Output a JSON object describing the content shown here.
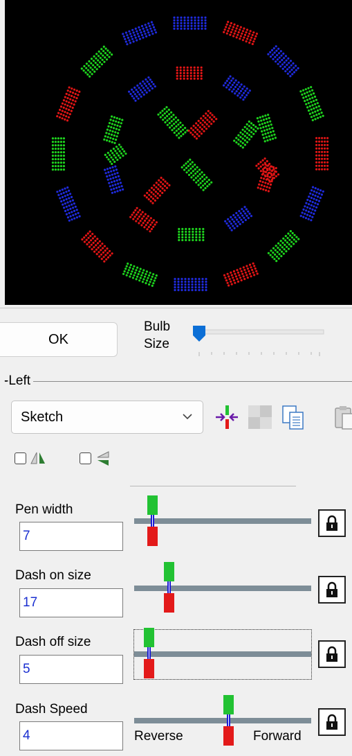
{
  "preview": {
    "icon": "led-dashed-circle-x-preview"
  },
  "controls": {
    "ok_label": "OK",
    "bulb_size_label_line1": "Bulb",
    "bulb_size_label_line2": "Size",
    "bulb_size_value": 0
  },
  "group": {
    "title": "Left"
  },
  "mode": {
    "selected": "Sketch"
  },
  "toolbar": {
    "icons": [
      "center-arrows-icon",
      "grid-pattern-icon",
      "copy-icon",
      "paste-icon"
    ]
  },
  "mirror": {
    "horizontal_checked": false,
    "vertical_checked": false,
    "icons": [
      "mirror-horizontal-icon",
      "mirror-vertical-icon"
    ]
  },
  "params": {
    "pen_width": {
      "label": "Pen width",
      "value": "7",
      "slider_fraction": 0.07,
      "lock_icon": "lock-icon"
    },
    "dash_on": {
      "label": "Dash on size",
      "value": "17",
      "slider_fraction": 0.17,
      "lock_icon": "lock-icon"
    },
    "dash_off": {
      "label": "Dash off size",
      "value": "5",
      "slider_fraction": 0.05,
      "lock_icon": "lock-icon"
    },
    "dash_speed": {
      "label": "Dash Speed",
      "value": "4",
      "slider_fraction": 0.53,
      "reverse_label": "Reverse",
      "forward_label": "Forward",
      "lock_icon": "lock-icon"
    }
  },
  "colors": {
    "led_red": "#e01515",
    "led_green": "#1ed21e",
    "led_blue": "#1f2bdc",
    "knob_green": "#22c233",
    "knob_red": "#e31a1a",
    "track": "#7d8d97",
    "value_text": "#1a2fd0"
  }
}
